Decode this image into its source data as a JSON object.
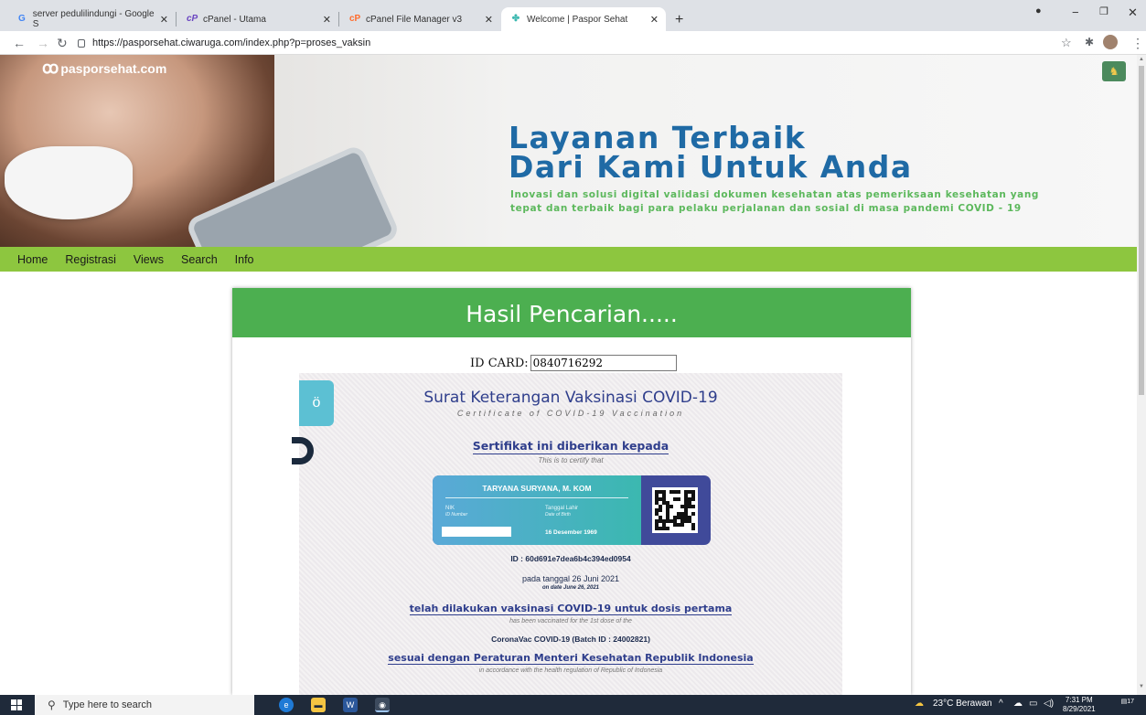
{
  "browser": {
    "tabs": [
      {
        "label": "server pedulilindungi - Google S",
        "icon": "G"
      },
      {
        "label": "cPanel - Utama",
        "icon": "cP"
      },
      {
        "label": "cPanel File Manager v3",
        "icon": "cP"
      },
      {
        "label": "Welcome | Paspor Sehat",
        "icon": "ps"
      }
    ],
    "url": "https://pasporsehat.ciwaruga.com/index.php?p=proses_vaksin"
  },
  "banner": {
    "logo": "pasporsehat.com",
    "title_line1": "Layanan Terbaik",
    "title_line2": "Dari Kami Untuk Anda",
    "subtitle": "Inovasi dan solusi digital validasi dokumen kesehatan atas pemeriksaan kesehatan yang tepat dan terbaik bagi para pelaku perjalanan dan sosial di masa pandemi COVID - 19"
  },
  "menu": [
    "Home",
    "Registrasi",
    "Views",
    "Search",
    "Info"
  ],
  "result": {
    "heading": "Hasil Pencarian.....",
    "id_label": "ID CARD:",
    "id_value": "0840716292"
  },
  "certificate": {
    "title": "Surat Keterangan Vaksinasi COVID-19",
    "title_en": "Certificate of COVID-19 Vaccination",
    "given_to": "Sertifikat ini diberikan kepada",
    "given_to_en": "This is to certify that",
    "name": "TARYANA SURYANA, M. KOM",
    "nik_label": "NIK",
    "nik_label_en": "ID Number",
    "dob_label": "Tanggal Lahir",
    "dob_label_en": "Date of Birth",
    "dob": "16 Desember 1969",
    "id_line": "ID : 60d691e7dea6b4c394ed0954",
    "date_line": "pada tanggal 26 Juni 2021",
    "date_line_en": "on date June 26, 2021",
    "vaccinated": "telah dilakukan vaksinasi COVID-19 untuk dosis pertama",
    "vaccinated_en": "has been vaccinated for the 1st dose of the",
    "vaccine": "CoronaVac COVID-19 (Batch ID : 24002821)",
    "regulation": "sesuai dengan Peraturan Menteri Kesehatan Republik Indonesia",
    "regulation_en": "in accordance with the health regulation of Republic of Indonesia"
  },
  "taskbar": {
    "search_placeholder": "Type here to search",
    "weather": "23°C  Berawan",
    "time": "7:31 PM",
    "date": "8/29/2021",
    "notif_count": "17"
  }
}
